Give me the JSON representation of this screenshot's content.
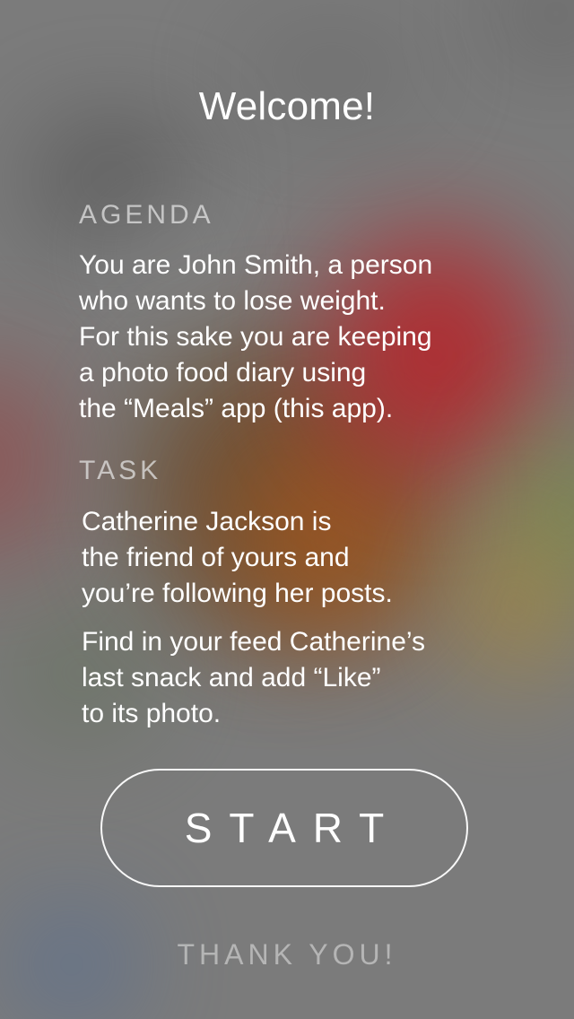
{
  "screen": {
    "title": "Welcome!",
    "agenda": {
      "label": "AGENDA",
      "text": "You are John Smith, a person\nwho wants to lose weight.\nFor this sake you are keeping\na photo food diary using\nthe “Meals” app (this app)."
    },
    "task": {
      "label": "TASK",
      "text_1": "Catherine Jackson is\nthe friend of yours and\nyou’re following her posts.",
      "text_2": "Find in your feed Catherine’s\nlast snack and add “Like”\nto its photo."
    },
    "start_label": "START",
    "thank_you_label": "THANK YOU!"
  },
  "colors": {
    "text": "#ffffff",
    "label_text": "#e6e6e6",
    "background": "#7b7b7b",
    "accent_red": "#b4262b"
  }
}
